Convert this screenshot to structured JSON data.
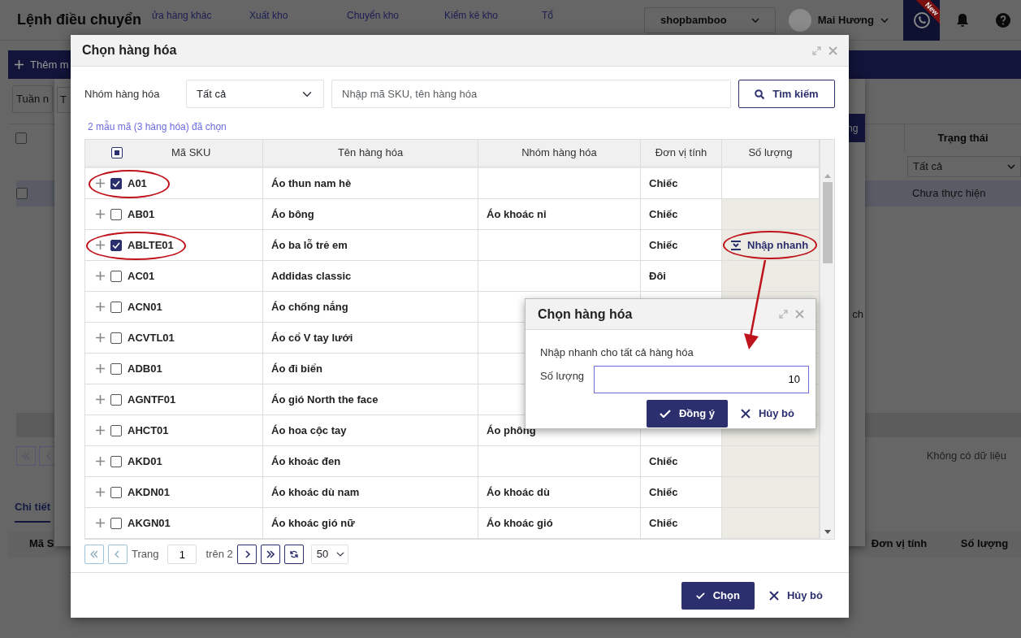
{
  "page": {
    "title": "Lệnh điều chuyển",
    "nav": [
      "ửa hàng khác",
      "Xuất kho",
      "Chuyển kho",
      "Kiểm kê kho",
      "Tổ"
    ],
    "store": "shopbamboo",
    "user": "Mai Hương",
    "new_badge": "New",
    "add_button": "Thêm m",
    "period_button": "Tuần n",
    "header_checked": false,
    "row_checked": false,
    "status_header": "Trạng thái",
    "status_filter": "Tất cả",
    "status_cell": "Chưa thực hiện",
    "empty_text": "Không có dữ liệu",
    "detail_tab": "Chi tiết",
    "detail_columns": [
      "Mã S",
      "Đơn vị tính",
      "Số lượng"
    ]
  },
  "back_dialog": {
    "left_button": "T",
    "right_button": "ng",
    "right_text": "ch"
  },
  "dialog": {
    "title": "Chọn hàng hóa",
    "group_label": "Nhóm hàng hóa",
    "group_value": "Tất cả",
    "search_placeholder": "Nhập mã SKU, tên hàng hóa",
    "search_button": "Tìm kiếm",
    "selection_summary": "2 mẫu mã (3 hàng hóa) đã chọn",
    "columns": [
      "Mã SKU",
      "Tên hàng hóa",
      "Nhóm hàng hóa",
      "Đơn vị tính",
      "Số lượng"
    ],
    "header_indeterminate": true,
    "rows": [
      {
        "sku": "A01",
        "name": "Áo thun nam hè",
        "group": "",
        "unit": "Chiếc",
        "checked": true,
        "circled": true,
        "qty_disabled": false
      },
      {
        "sku": "AB01",
        "name": "Áo bông",
        "group": "Áo khoác nỉ",
        "unit": "Chiếc",
        "checked": false,
        "circled": false,
        "qty_disabled": true
      },
      {
        "sku": "ABLTE01",
        "name": "Áo ba lỗ trẻ em",
        "group": "",
        "unit": "Chiếc",
        "checked": true,
        "circled": true,
        "qty_disabled": true,
        "quick_entry": {
          "label": "Nhập nhanh",
          "circled": true
        }
      },
      {
        "sku": "AC01",
        "name": "Addidas classic",
        "group": "",
        "unit": "Đôi",
        "checked": false,
        "circled": false,
        "qty_disabled": true
      },
      {
        "sku": "ACN01",
        "name": "Áo chống nắng",
        "group": "",
        "unit": "",
        "checked": false,
        "circled": false,
        "qty_disabled": true
      },
      {
        "sku": "ACVTL01",
        "name": "Áo cổ V tay lưới",
        "group": "",
        "unit": "",
        "checked": false,
        "circled": false,
        "qty_disabled": true
      },
      {
        "sku": "ADB01",
        "name": "Áo đi biển",
        "group": "",
        "unit": "",
        "checked": false,
        "circled": false,
        "qty_disabled": true
      },
      {
        "sku": "AGNTF01",
        "name": "Áo gió North the face",
        "group": "",
        "unit": "",
        "checked": false,
        "circled": false,
        "qty_disabled": true
      },
      {
        "sku": "AHCT01",
        "name": "Áo hoa cộc tay",
        "group": "Áo phông",
        "unit": "",
        "checked": false,
        "circled": false,
        "qty_disabled": true
      },
      {
        "sku": "AKD01",
        "name": "Áo khoác đen",
        "group": "",
        "unit": "Chiếc",
        "checked": false,
        "circled": false,
        "qty_disabled": true
      },
      {
        "sku": "AKDN01",
        "name": "Áo khoác dù nam",
        "group": "Áo khoác dù",
        "unit": "Chiếc",
        "checked": false,
        "circled": false,
        "qty_disabled": true
      },
      {
        "sku": "AKGN01",
        "name": "Áo khoác gió nữ",
        "group": "Áo khoác gió",
        "unit": "Chiếc",
        "checked": false,
        "circled": false,
        "qty_disabled": true
      }
    ],
    "pager": {
      "page_label": "Trang",
      "page": "1",
      "of_label": "trên 2",
      "page_size": "50"
    },
    "ok_button": "Chọn",
    "cancel_button": "Hủy bỏ"
  },
  "quick_dialog": {
    "title": "Chọn hàng hóa",
    "prompt": "Nhập nhanh cho tất cả hàng hóa",
    "qty_label": "Số lượng",
    "qty_value": "10",
    "ok_button": "Đồng ý",
    "cancel_button": "Hủy bỏ"
  }
}
